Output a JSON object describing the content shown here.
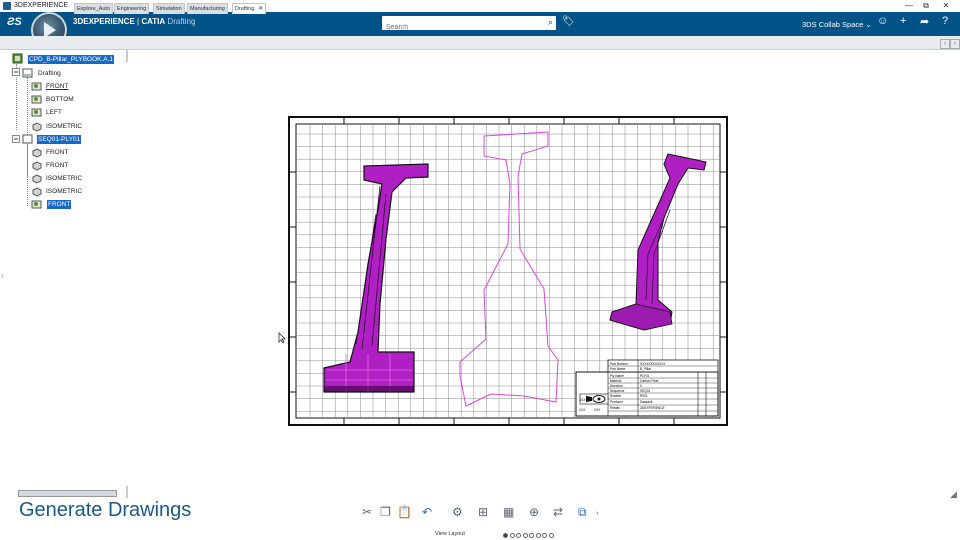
{
  "window": {
    "title": "3DEXPERIENCE",
    "controls": [
      "—",
      "⧉",
      "✕"
    ]
  },
  "header": {
    "brand_left": "3DEXPERIENCE",
    "brand_sep": " | ",
    "brand_app": "CATIA",
    "brand_mode": "Drafting",
    "search_placeholder": "Search",
    "collab_space": "3DS Collab Space",
    "accent_color": "#005386"
  },
  "tabs": [
    {
      "label": "Explore_Auto"
    },
    {
      "label": "Engineering"
    },
    {
      "label": "Simulation"
    },
    {
      "label": "Manufacturing"
    },
    {
      "label": "Drafting",
      "active": true
    }
  ],
  "tree": {
    "root": "CPD_B-Pillar_PLYBOOK.A.1",
    "drafting": "Drafting",
    "drafting_views": [
      "FRONT",
      "BOTTOM",
      "LEFT",
      "ISOMETRIC"
    ],
    "sheet": "SEQ01-PLY01",
    "sheet_views": [
      "FRONT",
      "FRONT",
      "ISOMETRIC",
      "ISOMETRIC",
      "FRONT"
    ]
  },
  "title_block": {
    "rows": [
      "Part Number",
      "Part Name",
      "Ply Name",
      "Material",
      "Direction",
      "Sequence",
      "Rosette",
      "Producer",
      "Retails"
    ],
    "values": [
      "XXXXXXXXXXXX",
      "B_Pillar",
      "PLY01",
      "Carbon Fiber",
      "0",
      "SEQ01",
      "R001",
      "Dassault",
      "3DEXPERIENCE"
    ],
    "small_labels": [
      "XXX",
      "XXX",
      "XXX"
    ]
  },
  "caption": "Generate Drawings",
  "toolbar": {
    "view_layout": "View Layout",
    "pages": 8,
    "active_page": 0
  },
  "colors": {
    "ply_fill": "#b01fc4",
    "ply_outline": "#d64ad8",
    "grid": "#8a8a8a"
  }
}
